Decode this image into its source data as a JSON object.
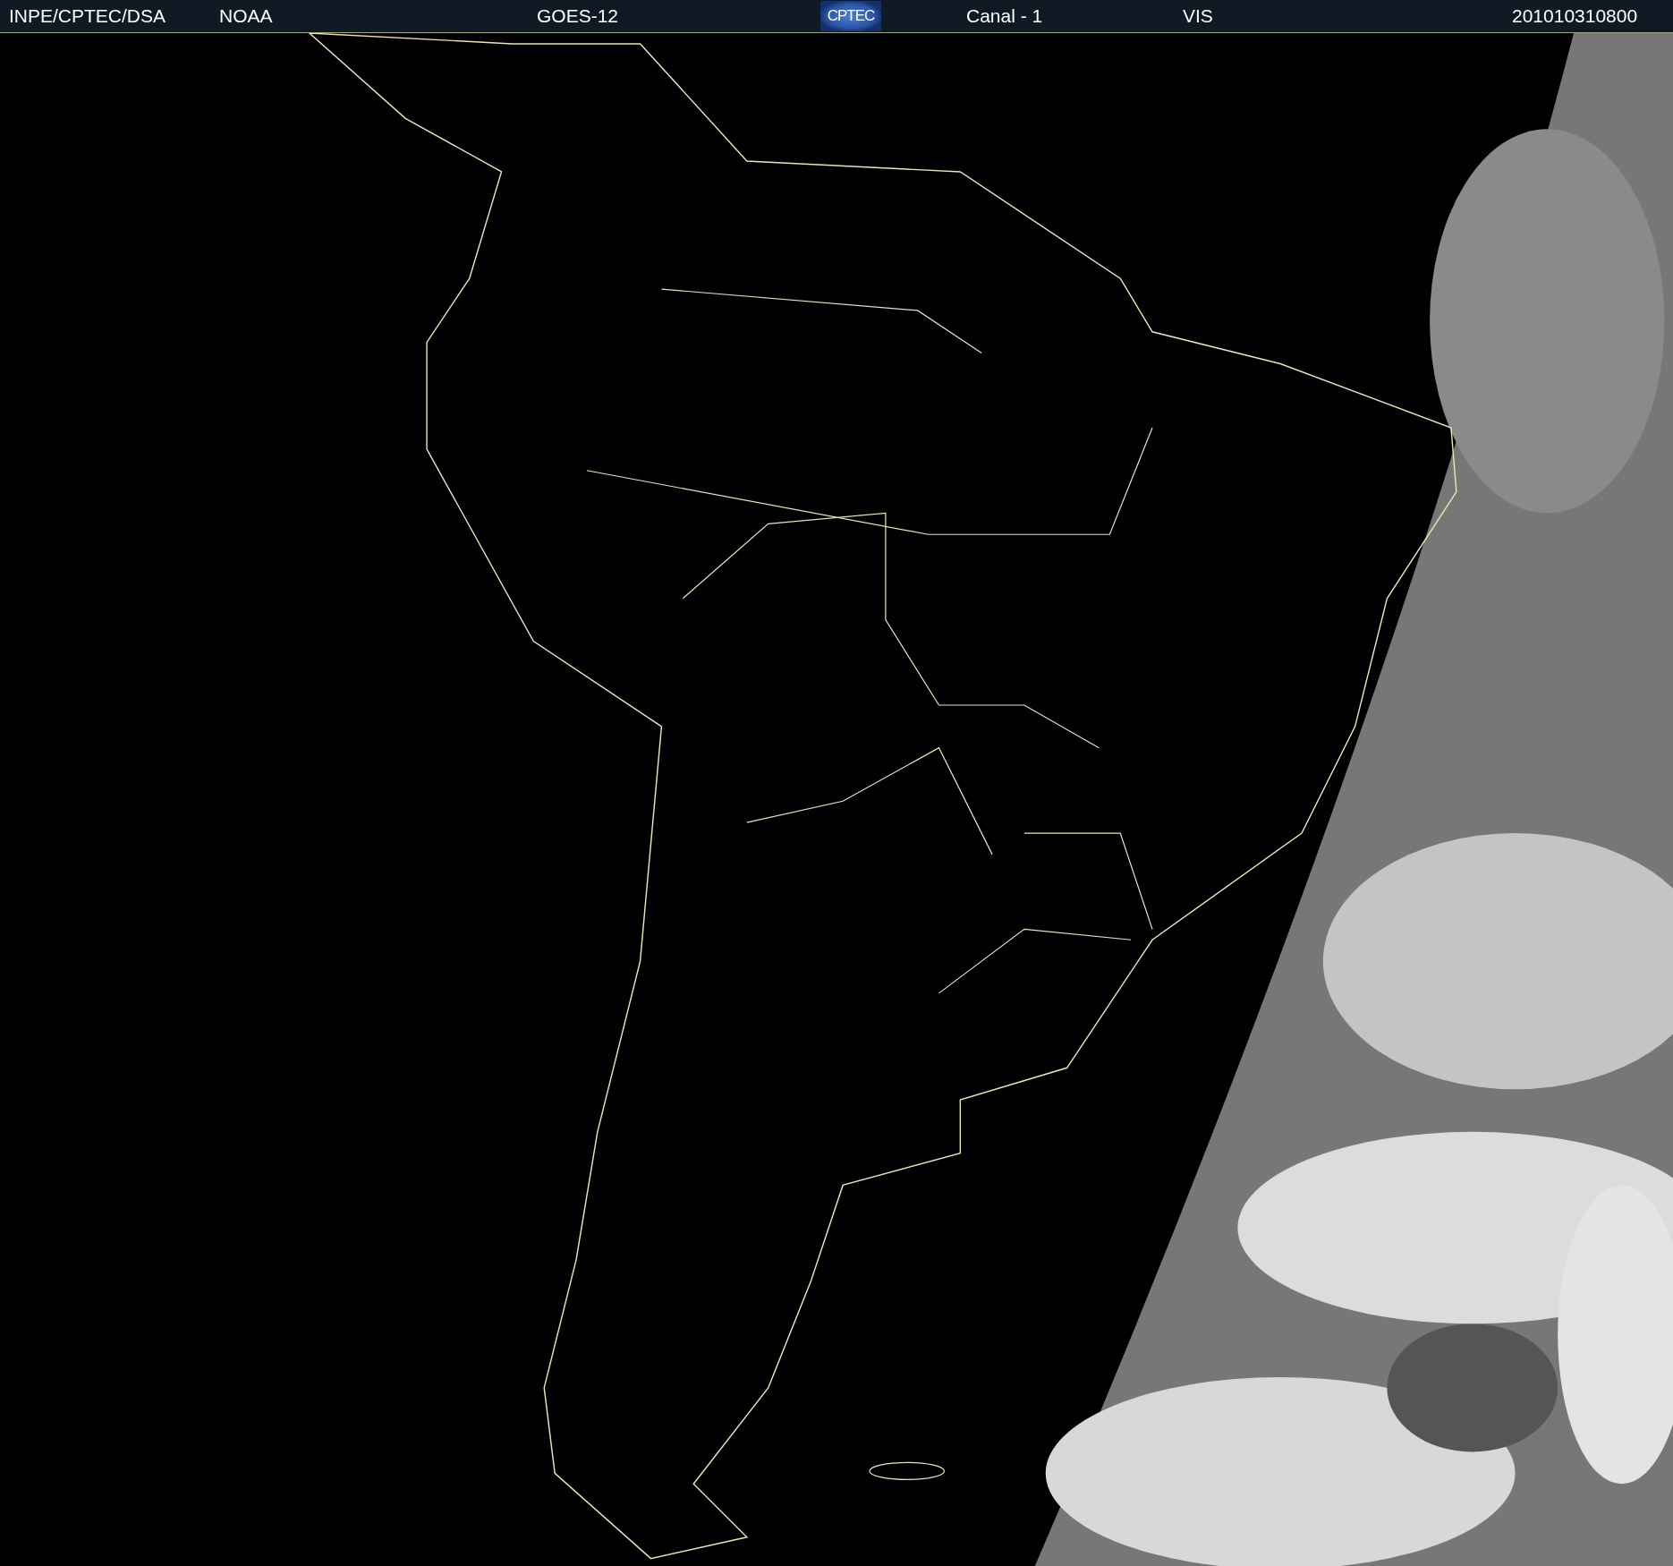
{
  "header": {
    "items": [
      {
        "kind": "text",
        "text": "INPE/CPTEC/DSA"
      },
      {
        "kind": "text",
        "text": "NOAA"
      },
      {
        "kind": "text",
        "text": "GOES-12"
      },
      {
        "kind": "logo",
        "text": "CPTEC"
      },
      {
        "kind": "text",
        "text": "Canal - 1"
      },
      {
        "kind": "text",
        "text": "VIS"
      },
      {
        "kind": "text",
        "text": "201010310800"
      }
    ]
  }
}
